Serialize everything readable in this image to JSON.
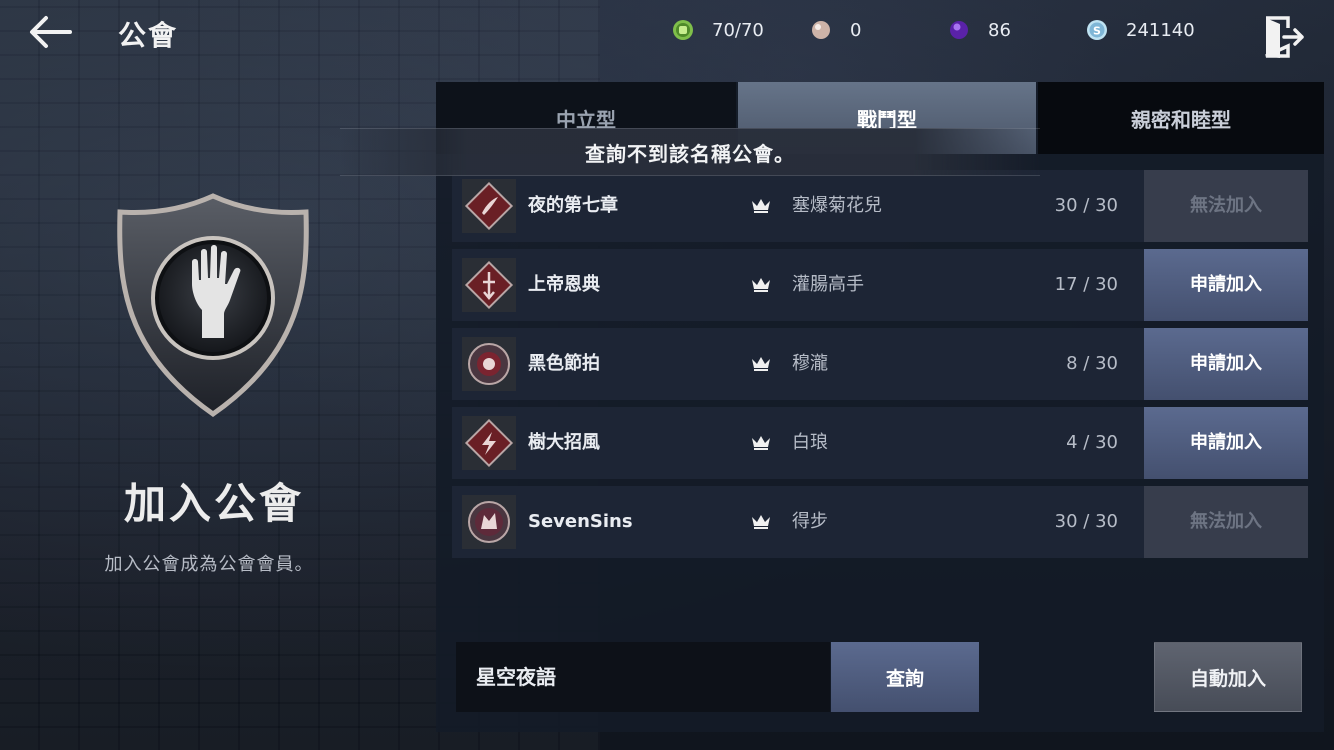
{
  "header": {
    "title": "公會",
    "back_icon": "back-arrow-icon",
    "exit_icon": "exit-door-icon"
  },
  "resources": [
    {
      "icon": "stamina-fist-icon",
      "color": "#7fbf4a",
      "value": "70/70"
    },
    {
      "icon": "pearl-icon",
      "color": "#d9c3b8",
      "value": "0"
    },
    {
      "icon": "purple-gem-icon",
      "color": "#7a3fd1",
      "value": "86"
    },
    {
      "icon": "silver-coin-icon",
      "color": "#9fd0e8",
      "value": "241140"
    }
  ],
  "left_panel": {
    "emblem_icon": "guild-hand-shield-icon",
    "title": "加入公會",
    "subtitle": "加入公會成為公會會員。"
  },
  "tabs": [
    {
      "label": "中立型",
      "selected": false
    },
    {
      "label": "戰鬥型",
      "selected": true
    },
    {
      "label": "親密和睦型",
      "selected": false
    }
  ],
  "toast": "查詢不到該名稱公會。",
  "guilds": [
    {
      "name": "夜的第七章",
      "leader": "塞爆菊花兒",
      "count": "30 / 30",
      "button": "無法加入",
      "enabled": false,
      "crest": "wing-crest-icon"
    },
    {
      "name": "上帝恩典",
      "leader": "灌腸高手",
      "count": "17 / 30",
      "button": "申請加入",
      "enabled": true,
      "crest": "sword-crest-icon"
    },
    {
      "name": "黑色節拍",
      "leader": "穆瀧",
      "count": "8 / 30",
      "button": "申請加入",
      "enabled": true,
      "crest": "circle-crest-icon"
    },
    {
      "name": "樹大招風",
      "leader": "白琅",
      "count": "4 / 30",
      "button": "申請加入",
      "enabled": true,
      "crest": "lightning-crest-icon"
    },
    {
      "name": "SevenSins",
      "leader": "得步",
      "count": "30 / 30",
      "button": "無法加入",
      "enabled": false,
      "crest": "wolf-crest-icon"
    }
  ],
  "search": {
    "value": "星空夜語",
    "button": "查詢"
  },
  "auto_join": "自動加入"
}
